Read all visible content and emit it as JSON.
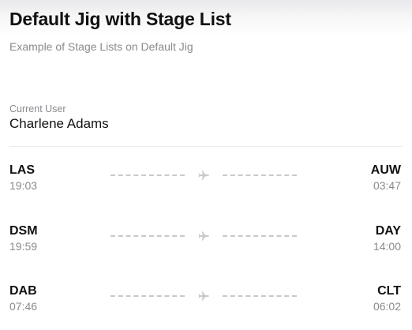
{
  "header": {
    "title": "Default Jig with Stage List",
    "subtitle": "Example of Stage Lists on Default Jig"
  },
  "user": {
    "label": "Current User",
    "name": "Charlene Adams"
  },
  "flights": [
    {
      "from": "LAS",
      "from_time": "19:03",
      "to": "AUW",
      "to_time": "03:47",
      "icon": "airplane-icon"
    },
    {
      "from": "DSM",
      "from_time": "19:59",
      "to": "DAY",
      "to_time": "14:00",
      "icon": "airplane-icon"
    },
    {
      "from": "DAB",
      "from_time": "07:46",
      "to": "CLT",
      "to_time": "06:02",
      "icon": "airplane-icon"
    }
  ]
}
